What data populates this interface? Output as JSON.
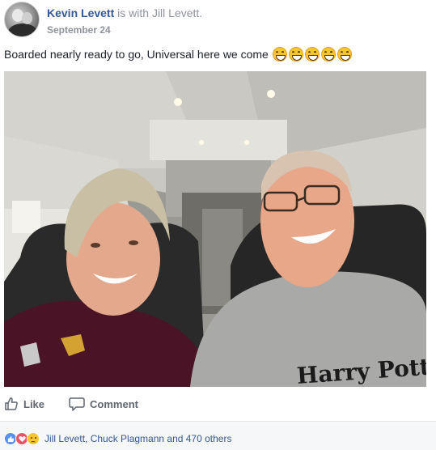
{
  "post": {
    "author": "Kevin Levett",
    "with_text": "is with",
    "with_name": "Jill Levett",
    "date": "September 24",
    "text": "Boarded nearly ready to go, Universal here we come",
    "emoji_name": "grinning-face-icon",
    "emoji_count": 5
  },
  "photo": {
    "description_icon": "selfie-photo",
    "hoodie_print": "Harry Potter"
  },
  "actions": {
    "like_label": "Like",
    "comment_label": "Comment"
  },
  "reactions": {
    "icons": [
      "like-icon",
      "love-icon",
      "sad-icon"
    ],
    "summary": "Jill Levett, Chuck Plagmann and 470 others"
  },
  "colors": {
    "link": "#365899",
    "meta": "#90949c",
    "action": "#606770",
    "like": "#5890ff",
    "love": "#f25268"
  }
}
